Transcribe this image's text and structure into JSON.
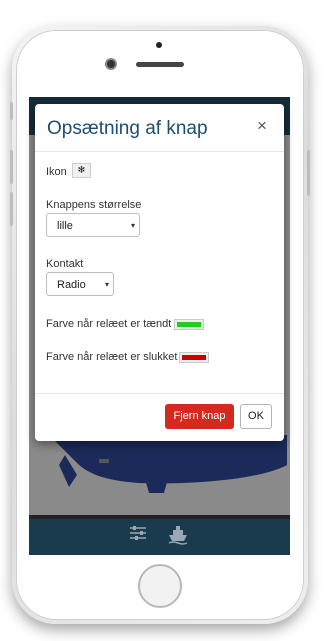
{
  "modal": {
    "title": "Opsætning af knap",
    "close": "×",
    "icon_label": "Ikon",
    "icon_glyph": "❄",
    "size_label": "Knappens størrelse",
    "size_value": "lille",
    "contact_label": "Kontakt",
    "contact_value": "Radio",
    "color_on_label": "Farve når relæet er tændt",
    "color_on": "#22cc22",
    "color_off_label": "Farve når relæet er slukket",
    "color_off": "#cc0000",
    "remove_button": "Fjern knap",
    "ok_button": "OK"
  },
  "caret": "▾",
  "colors": {
    "header": "#152d3b",
    "footer": "#1a3a4e",
    "title": "#1e4d70",
    "boat_hull": "#1c2a5a"
  },
  "footer_icons": [
    "sliders-icon",
    "ship-icon"
  ]
}
